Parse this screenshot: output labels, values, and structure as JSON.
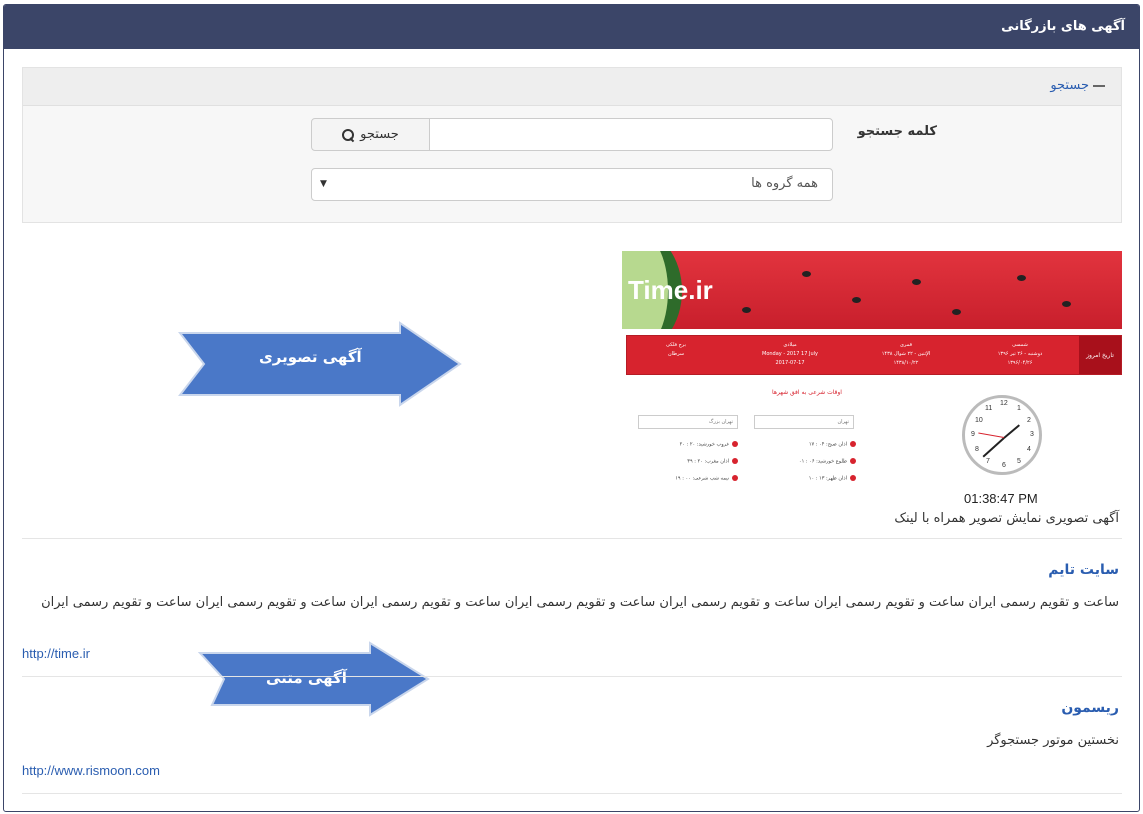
{
  "header": {
    "title": "آگهی های بازرگانی"
  },
  "search": {
    "toggle_label": "جستجو",
    "keyword_label": "کلمه جستجو",
    "keyword_value": "",
    "search_button": "جستجو",
    "group_selected": "همه گروه ها"
  },
  "image_ad": {
    "banner_logo": "Time.ir",
    "bar_today": "تاریخ امروز",
    "bar_shamsi_title": "شمسی",
    "bar_shamsi_line1": "دوشنبه - ۲۶ تیر ۱۳۹۶",
    "bar_shamsi_line2": "۱۳۹۶/۰۴/۲۶",
    "bar_qamari_title": "قمری",
    "bar_qamari_line1": "الإثنين - ۲۲ شوال ۱۴۳۸",
    "bar_qamari_line2": "۱۴۳۸/۱۰/۲۲",
    "bar_miladi_title": "میلادی",
    "bar_miladi_line1": "Monday - 2017 17 July",
    "bar_miladi_line2": "2017-07-17",
    "bar_burj_title": "برج فلکی",
    "bar_burj_line1": "سرطان",
    "prayer_title": "اوقات شرعی به افق شهرها",
    "select_city1": "تهران",
    "select_city2": "تهران بزرگ",
    "prayer_rows": [
      "اذان صبح: ۰۴ : ۱۷",
      "غروب خورشید: ۲۰ : ۲۰",
      "طلوع خورشید: ۰۶ : ۰۱",
      "اذان مغرب: ۲۰ : ۳۹",
      "اذان ظهر: ۱۳ : ۱۰",
      "نیمه شب شرعی: ۰۰ : ۱۹"
    ],
    "clock_time": "01:38:47 PM",
    "caption": "آگهی تصویری نمایش تصویر همراه با لینک"
  },
  "annotations": {
    "image_arrow": "آگهی تصویری",
    "text_arrow": "آگهی متنی"
  },
  "text_ads": [
    {
      "title": "سایت تایم",
      "body": "ساعت و تقویم رسمی ایران ساعت و تقویم رسمی ایران ساعت و تقویم رسمی ایران ساعت و تقویم رسمی ایران ساعت و تقویم رسمی ایران ساعت و تقویم رسمی ایران ساعت و تقویم رسمی ایران",
      "link": "http://time.ir"
    },
    {
      "title": "ریسمون",
      "body": "نخستین موتور جستجوگر",
      "link": "http://www.rismoon.com"
    }
  ],
  "colors": {
    "header_bg": "#3b4568",
    "link": "#2a5db0",
    "arrow": "#4a78c8",
    "banner_red": "#d7232e"
  }
}
